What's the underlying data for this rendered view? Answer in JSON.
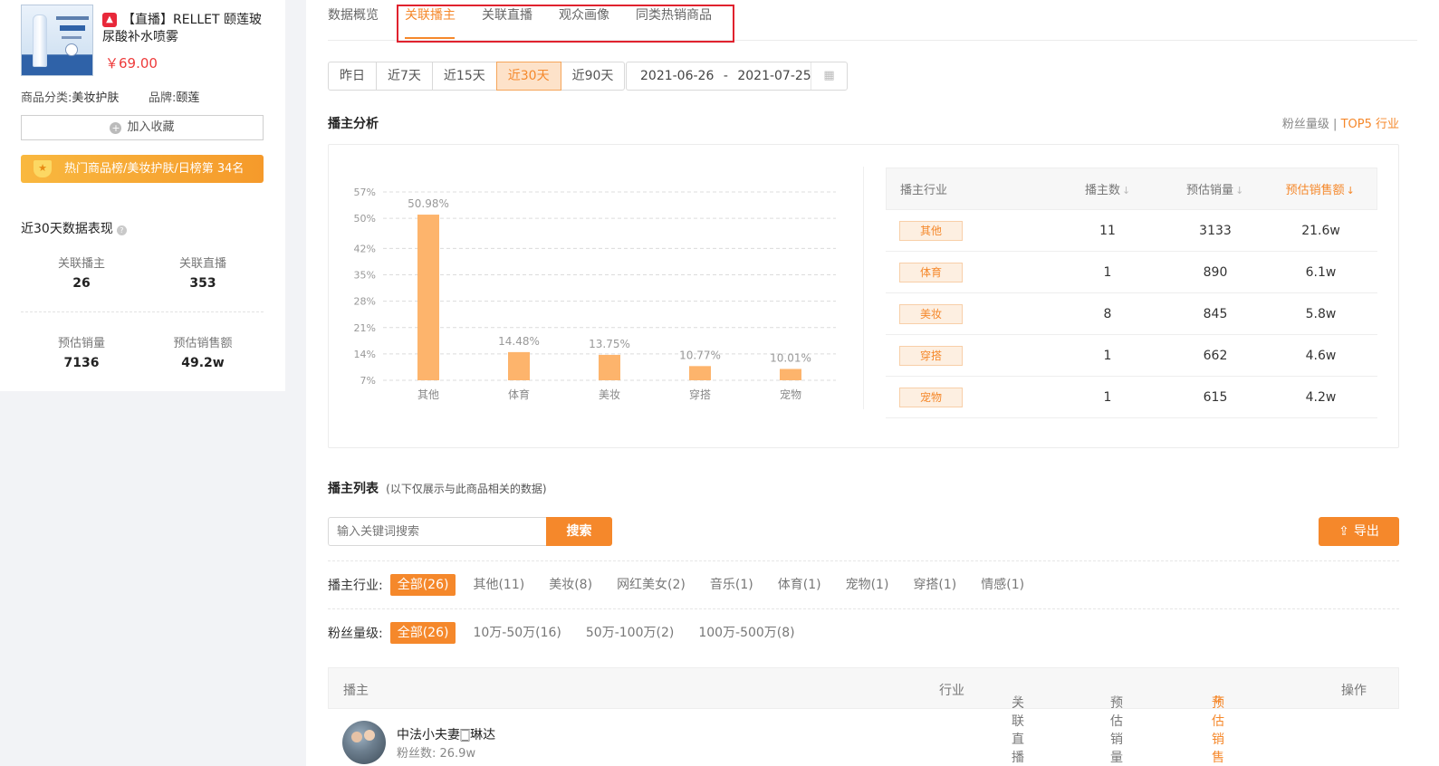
{
  "product": {
    "live_badge": "▲",
    "title": "【直播】RELLET 颐莲玻尿酸补水喷雾",
    "price": "￥69.00",
    "category_label": "商品分类:",
    "category_value": "美妆护肤",
    "brand_label": "品牌:",
    "brand_value": "颐莲",
    "favorite_button": "加入收藏",
    "rank_text": "热门商品榜/美妆护肤/日榜第 34名"
  },
  "summary": {
    "title": "近30天数据表现",
    "stats": [
      {
        "label": "关联播主",
        "value": "26"
      },
      {
        "label": "关联直播",
        "value": "353"
      },
      {
        "label": "预估销量",
        "value": "7136"
      },
      {
        "label": "预估销售额",
        "value": "49.2w"
      }
    ]
  },
  "tabs": [
    "数据概览",
    "关联播主",
    "关联直播",
    "观众画像",
    "同类热销商品"
  ],
  "active_tab": "关联播主",
  "date_ranges": [
    "昨日",
    "近7天",
    "近15天",
    "近30天",
    "近90天"
  ],
  "selected_range": "近30天",
  "date_range": {
    "start": "2021-06-26",
    "separator": "-",
    "end": "2021-07-25"
  },
  "anchor_analysis": {
    "title": "播主分析",
    "toggle_fans": "粉丝量级",
    "toggle_sep": "|",
    "toggle_industry": "TOP5 行业"
  },
  "chart_data": {
    "type": "bar",
    "categories": [
      "其他",
      "体育",
      "美妆",
      "穿搭",
      "宠物"
    ],
    "values": [
      50.98,
      14.48,
      13.75,
      10.77,
      10.01
    ],
    "data_labels": [
      "50.98%",
      "14.48%",
      "13.75%",
      "10.77%",
      "10.01%"
    ],
    "y_ticks": [
      "7%",
      "14%",
      "21%",
      "28%",
      "35%",
      "42%",
      "50%",
      "57%"
    ],
    "y_tick_values": [
      7,
      14,
      21,
      28,
      35,
      42,
      50,
      57
    ],
    "ylim": [
      7,
      57
    ],
    "grid": true,
    "color": "#fdb46c"
  },
  "industry_table": {
    "headers": [
      "播主行业",
      "播主数",
      "预估销量",
      "预估销售额"
    ],
    "rows": [
      {
        "industry": "其他",
        "count": "11",
        "sales": "3133",
        "revenue": "21.6w"
      },
      {
        "industry": "体育",
        "count": "1",
        "sales": "890",
        "revenue": "6.1w"
      },
      {
        "industry": "美妆",
        "count": "8",
        "sales": "845",
        "revenue": "5.8w"
      },
      {
        "industry": "穿搭",
        "count": "1",
        "sales": "662",
        "revenue": "4.6w"
      },
      {
        "industry": "宠物",
        "count": "1",
        "sales": "615",
        "revenue": "4.2w"
      }
    ]
  },
  "anchor_list": {
    "title": "播主列表",
    "subtitle": "(以下仅展示与此商品相关的数据)",
    "search_placeholder": "输入关键词搜索",
    "search_button": "搜索",
    "export_button": "导出",
    "industry_label": "播主行业:",
    "industry_filters": [
      "全部(26)",
      "其他(11)",
      "美妆(8)",
      "网红美女(2)",
      "音乐(1)",
      "体育(1)",
      "宠物(1)",
      "穿搭(1)",
      "情感(1)"
    ],
    "fans_label": "粉丝量级:",
    "fans_filters": [
      "全部(26)",
      "10万-50万(16)",
      "50万-100万(2)",
      "100万-500万(8)"
    ],
    "columns": [
      "播主",
      "行业",
      "关联直播",
      "预估销量",
      "预估销售额",
      "操作"
    ],
    "first_anchor": {
      "name": "中法小夫妻🀆琳达",
      "fans": "粉丝数: 26.9w"
    }
  },
  "colors": {
    "accent": "#f5882b",
    "price": "#ee3b3b",
    "highlight_box": "#e0222e",
    "bar": "#fdb46c"
  }
}
